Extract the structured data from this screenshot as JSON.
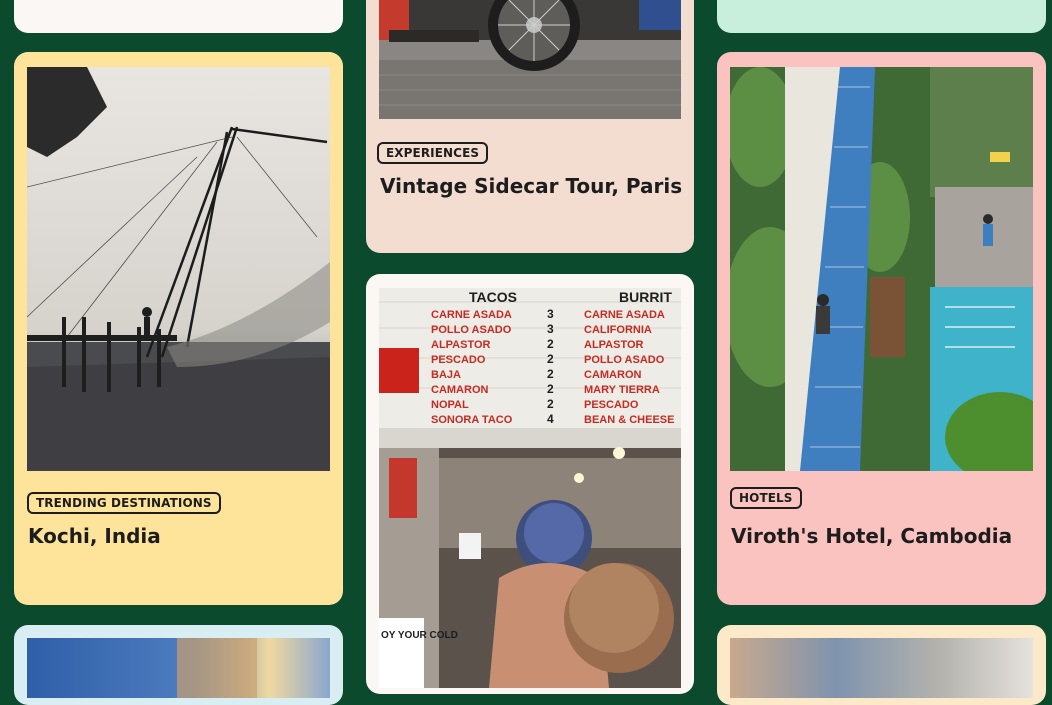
{
  "cards": {
    "top_left": {},
    "kochi": {
      "tag": "TRENDING DESTINATIONS",
      "title": "Kochi, India"
    },
    "sidecar": {
      "tag": "EXPERIENCES",
      "title": "Vintage Sidecar Tour, Paris"
    },
    "tacos": {
      "menu_left": [
        "CARNE ASADA",
        "POLLO ASADO",
        "ALPASTOR",
        "PESCADO",
        "BAJA",
        "CAMARON",
        "NOPAL",
        "SONORA TACO"
      ],
      "menu_left_prices": [
        "3",
        "3",
        "2",
        "2",
        "2",
        "2",
        "2",
        "4"
      ],
      "menu_right": [
        "CARNE ASADA",
        "CALIFORNIA",
        "ALPASTOR",
        "POLLO ASADO",
        "CAMARON",
        "MARY TIERRA",
        "PESCADO",
        "BEAN & CHEESE"
      ],
      "header_left": "TACOS",
      "header_right": "BURRIT",
      "sign_text": "OY YOUR COLD"
    },
    "viroth": {
      "tag": "HOTELS",
      "title": "Viroth's Hotel, Cambodia"
    },
    "top_right": {}
  },
  "colors": {
    "page_bg": "#0b4a2c",
    "card_white": "#fbf7f4",
    "card_yellow": "#fde49a",
    "card_beige": "#f3ddd1",
    "card_pink": "#fbc3c0",
    "card_mint": "#c7efdc",
    "card_lightblue": "#d8eef2"
  }
}
